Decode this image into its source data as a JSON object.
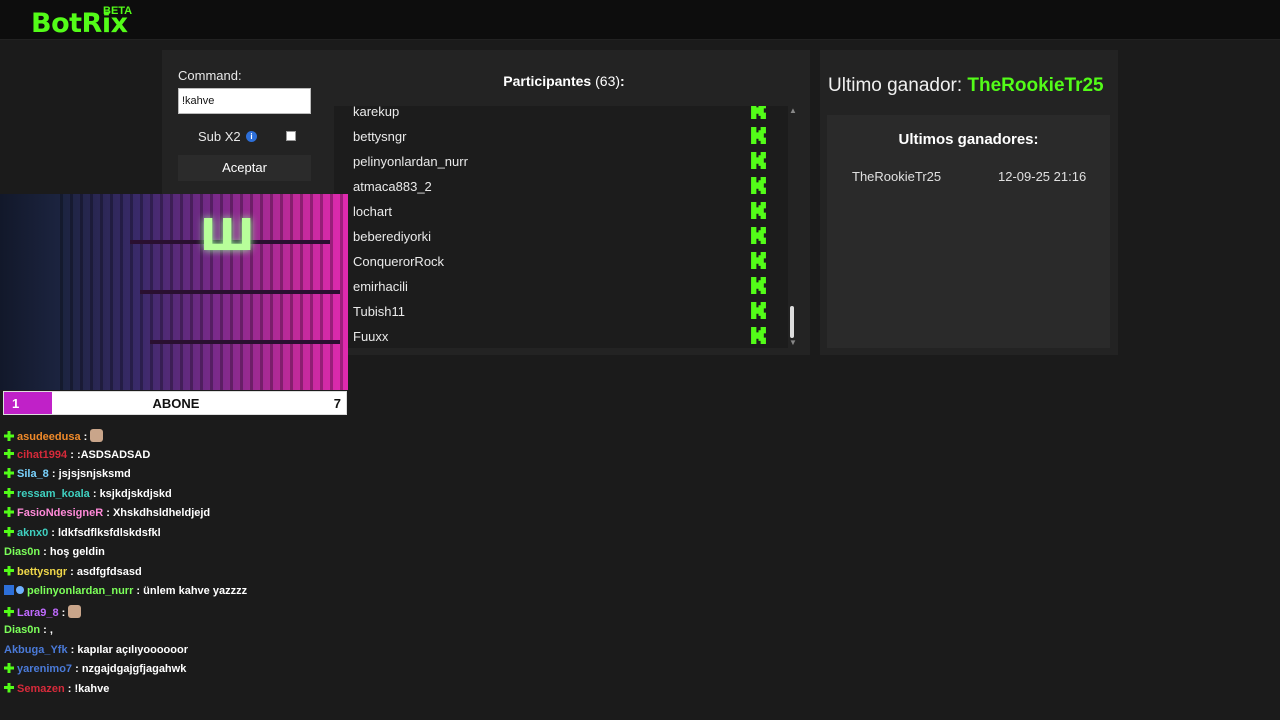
{
  "app": {
    "name": "BotRix",
    "tag": "BETA"
  },
  "command": {
    "label": "Command:",
    "value": "!kahve"
  },
  "sub_x2": {
    "label": "Sub X2",
    "checked": false
  },
  "accept_button": "Aceptar",
  "participants": {
    "title": "Participantes",
    "count_text": "(63)",
    "suffix": ":",
    "items": [
      "karekup",
      "bettysngr",
      "pelinyonlardan_nurr",
      "atmaca883_2",
      "lochart",
      "beberediyorki",
      "ConquerorRock",
      "emirhacili",
      "Tubish11",
      "Fuuxx"
    ]
  },
  "winner": {
    "label": "Ultimo ganador:",
    "name": "TheRookieTr25"
  },
  "winners_list": {
    "title": "Ultimos ganadores:",
    "rows": [
      {
        "name": "TheRookieTr25",
        "date": "12-09-25 21:16"
      }
    ]
  },
  "sub_goal": {
    "current": "1",
    "label": "ABONE",
    "target": "7",
    "progress": 0.14
  },
  "chat": [
    {
      "user": "asudeedusa",
      "color": "#f08a2a",
      "badge": "plus",
      "message": "",
      "emote": true
    },
    {
      "user": "cihat1994",
      "color": "#d62a3a",
      "badge": "plus",
      "message": ":ASDSADSAD"
    },
    {
      "user": "Sila_8",
      "color": "#7ad4ff",
      "badge": "plus",
      "message": "jsjsjsnjsksmd"
    },
    {
      "user": "ressam_koala",
      "color": "#3fd0c0",
      "badge": "plus",
      "message": "ksjkdjskdjskd"
    },
    {
      "user": "FasioNdesigneR",
      "color": "#ff8ad8",
      "badge": "plus",
      "message": "Xhskdhsldheldjejd"
    },
    {
      "user": "aknx0",
      "color": "#3fd0c0",
      "badge": "plus",
      "message": "ldkfsdflksfdlskdsfkl"
    },
    {
      "user": "Dias0n",
      "color": "#7cff5a",
      "badge": "none",
      "message": "hoş geldin"
    },
    {
      "user": "bettysngr",
      "color": "#f0d84a",
      "badge": "plus",
      "message": "asdfgfdsasd"
    },
    {
      "user": "pelinyonlardan_nurr",
      "color": "#7cff5a",
      "badge": "mod",
      "message": "ünlem kahve yazzzz"
    },
    {
      "user": "Lara9_8",
      "color": "#c06aff",
      "badge": "plus",
      "message": "",
      "emote": true
    },
    {
      "user": "Dias0n",
      "color": "#7cff5a",
      "badge": "none",
      "message": ","
    },
    {
      "user": "Akbuga_Yfk",
      "color": "#4a7ad8",
      "badge": "none",
      "message": "kapılar açılıyoooooor"
    },
    {
      "user": "yarenimo7",
      "color": "#4a7ad8",
      "badge": "plus",
      "message": "nzgajdgajgfjagahwk"
    },
    {
      "user": "Semazen",
      "color": "#d62a3a",
      "badge": "plus",
      "message": "!kahve"
    }
  ],
  "colors": {
    "accent": "#53fc18",
    "sub_goal_fill": "#c021c8"
  }
}
